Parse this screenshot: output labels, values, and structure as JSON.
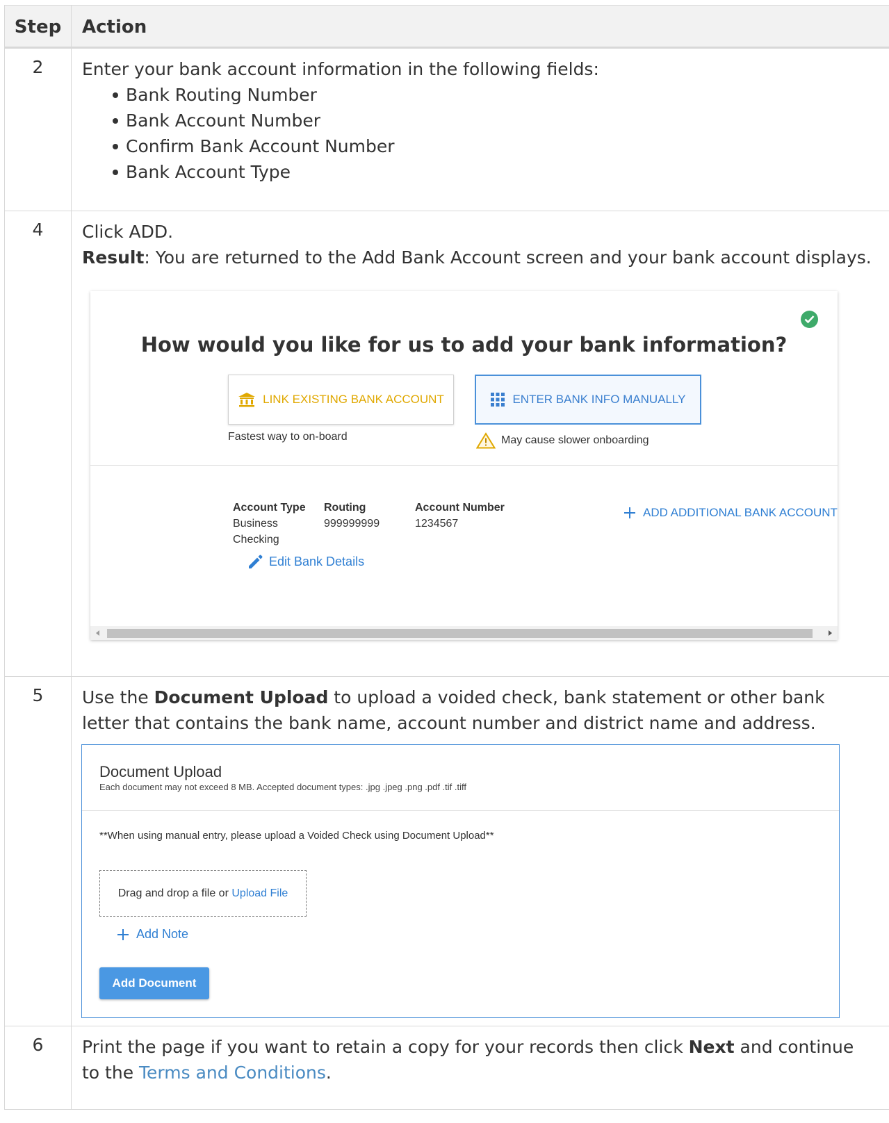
{
  "table": {
    "header": {
      "step": "Step",
      "action": "Action"
    },
    "rows": [
      {
        "step": "2",
        "intro": "Enter your bank account information in the following fields:",
        "fields": [
          "Bank Routing Number",
          "Bank Account Number",
          "Confirm Bank Account Number",
          "Bank Account Type"
        ]
      },
      {
        "step": "4",
        "line1": "Click ADD.",
        "result_label": "Result",
        "result_text": ": You are returned to the Add Bank Account screen and your bank account displays."
      },
      {
        "step": "5",
        "text_pre": "Use the ",
        "text_bold": "Document Upload",
        "text_post": " to upload a voided check, bank statement or other bank letter that contains the bank name, account number and district name and address."
      },
      {
        "step": "6",
        "text_pre": "Print the page if you want to retain a copy for your records then click ",
        "text_bold": "Next",
        "text_mid": " and continue to the ",
        "link": "Terms and Conditions",
        "text_post": "."
      }
    ]
  },
  "bank_screen": {
    "question": "How would you like for us to add your bank information?",
    "link_button": "LINK EXISTING BANK ACCOUNT",
    "manual_button": "ENTER BANK INFO MANUALLY",
    "link_sub": "Fastest way to on-board",
    "manual_sub": "May cause slower onboarding",
    "account": {
      "type_label": "Account Type",
      "type_value_1": "Business",
      "type_value_2": "Checking",
      "routing_label": "Routing",
      "routing_value": "999999999",
      "number_label": "Account Number",
      "number_value": "1234567"
    },
    "edit_link": "Edit Bank Details",
    "add_additional": "ADD ADDITIONAL BANK ACCOUNT",
    "colors": {
      "link_accent": "#e0a800",
      "manual_accent": "#3a7fcf",
      "success": "#3eaa6a"
    }
  },
  "doc_upload": {
    "title": "Document Upload",
    "subtitle": "Each document may not exceed 8 MB. Accepted document types: .jpg .jpeg .png .pdf .tif .tiff",
    "note": "**When using manual entry, please upload a Voided Check using Document Upload**",
    "drop_text": "Drag and drop a file or ",
    "upload_link": "Upload File",
    "add_note": "Add Note",
    "add_document": "Add Document",
    "colors": {
      "button": "#4a98e3"
    }
  }
}
